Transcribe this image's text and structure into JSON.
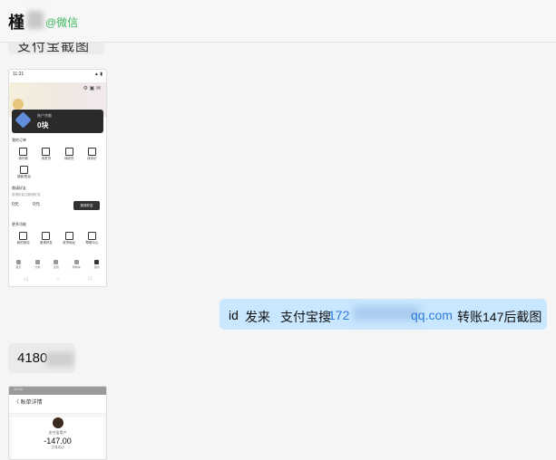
{
  "header": {
    "title": "槿",
    "source": "@微信"
  },
  "top_bubble": {
    "text": "支付宝截图"
  },
  "thumb1": {
    "status_left": "11:21",
    "status_right": "▲ ▮",
    "wallet_label": "账户余额",
    "wallet_value": "0块",
    "section1_title": "我的订单",
    "grid1": [
      "待付款",
      "待发货",
      "待收货",
      "待评价",
      "退款/售后"
    ],
    "section2_title": "邀请好友",
    "section2_line": "邀请好友注册领红包",
    "section2_nums": [
      "0元",
      "0元"
    ],
    "section2_btn": "邀请好友",
    "section3_title": "更多功能",
    "grid2": [
      "我的钱包",
      "邀请好友",
      "收货地址",
      "帮助中心"
    ],
    "tabbar": [
      "首页",
      "分类",
      "发现",
      "购物车",
      "我的"
    ],
    "nav": [
      "◁",
      "○",
      "□"
    ]
  },
  "message_right": {
    "part1": "id",
    "part2": "发来",
    "part3": "支付宝搜",
    "email_prefix": "172",
    "email_suffix": "qq.com",
    "part4": "转账147后截图"
  },
  "message_mid": {
    "text": "4180"
  },
  "thumb2": {
    "status": "11:23",
    "nav_title": "〈  账单详情",
    "name": "支付宝用户",
    "amount": "-147.00",
    "state": "交易成功"
  }
}
